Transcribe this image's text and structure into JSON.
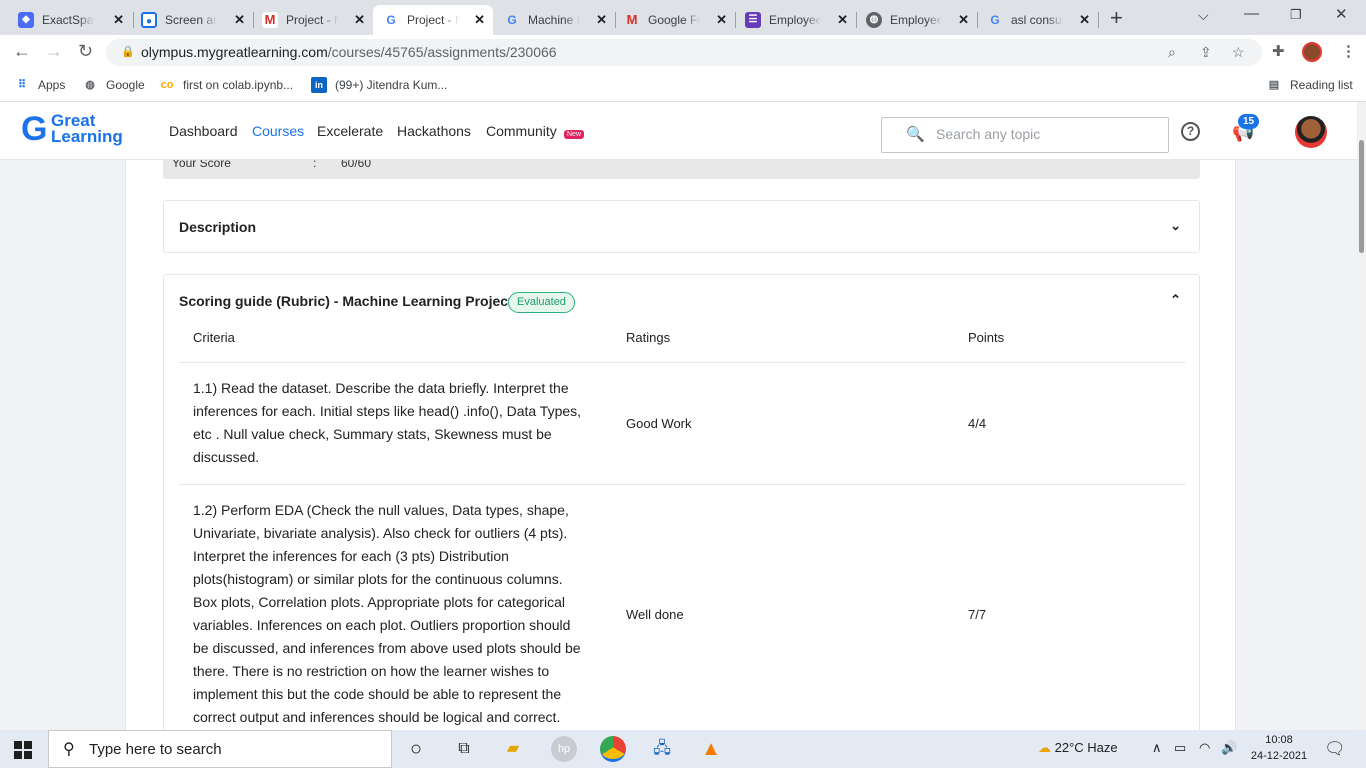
{
  "browser": {
    "tabs": [
      {
        "label": "ExactSpace",
        "icon": "exactspace-icon",
        "color": "#4a6cf7",
        "active": false
      },
      {
        "label": "Screen and",
        "icon": "screencast-icon",
        "color": "#1a73e8",
        "active": false
      },
      {
        "label": "Project - M",
        "icon": "gmail-icon",
        "color": "#d93025",
        "active": false
      },
      {
        "label": "Project - M",
        "icon": "google-icon",
        "color": "#4285f4",
        "active": true
      },
      {
        "label": "Machine Le",
        "icon": "google-icon",
        "color": "#4285f4",
        "active": false
      },
      {
        "label": "Google Fo",
        "icon": "gmail-icon",
        "color": "#d93025",
        "active": false
      },
      {
        "label": "Employee",
        "icon": "forms-icon",
        "color": "#673ab7",
        "active": false
      },
      {
        "label": "Employee",
        "icon": "globe-icon",
        "color": "#5f6368",
        "active": false
      },
      {
        "label": "asl consult",
        "icon": "google-icon",
        "color": "#4285f4",
        "active": false
      }
    ],
    "url": "olympus.mygreatlearning.com",
    "url_path": "/courses/45765/assignments/230066",
    "bookmarks": [
      {
        "label": "Apps",
        "icon": "apps-grid-icon"
      },
      {
        "label": "Google",
        "icon": "globe-icon"
      },
      {
        "label": "first on colab.ipynb...",
        "icon": "colab-icon"
      },
      {
        "label": "(99+) Jitendra Kum...",
        "icon": "linkedin-icon"
      }
    ],
    "reading_list": "Reading list"
  },
  "site": {
    "logo_line1": "Great",
    "logo_line2": "Learning",
    "nav": [
      {
        "label": "Dashboard",
        "active": false
      },
      {
        "label": "Courses",
        "active": true
      },
      {
        "label": "Excelerate",
        "active": false
      },
      {
        "label": "Hackathons",
        "active": false
      },
      {
        "label": "Community",
        "active": false
      }
    ],
    "new_badge": "New",
    "search_placeholder": "Search any topic",
    "notification_count": "15"
  },
  "assignment": {
    "score_label": "Your Score",
    "score_colon": ":",
    "score_value": "60/60",
    "description_title": "Description",
    "rubric": {
      "title": "Scoring guide (Rubric) - Machine Learning Project",
      "badge": "Evaluated",
      "columns": [
        "Criteria",
        "Ratings",
        "Points"
      ],
      "rows": [
        {
          "criteria": "1.1) Read the dataset. Describe the data briefly. Interpret the inferences for each. Initial steps like head() .info(), Data Types, etc . Null value check, Summary stats, Skewness must be discussed.",
          "rating": "Good Work",
          "points": "4/4"
        },
        {
          "criteria": "1.2) Perform EDA (Check the null values, Data types, shape, Univariate, bivariate analysis). Also check for outliers (4 pts). Interpret the inferences for each (3 pts) Distribution plots(histogram) or similar plots for the continuous columns. Box plots, Correlation plots. Appropriate plots for categorical variables. Inferences on each plot. Outliers proportion should be discussed, and inferences from above used plots should be there. There is no restriction on how the learner wishes to implement this but the code should be able to represent the correct output and inferences should be logical and correct.",
          "rating": "Well done",
          "points": "7/7"
        }
      ]
    }
  },
  "taskbar": {
    "search_text": "Type here to search",
    "weather": "22°C  Haze",
    "time": "10:08",
    "date": "24-12-2021"
  }
}
